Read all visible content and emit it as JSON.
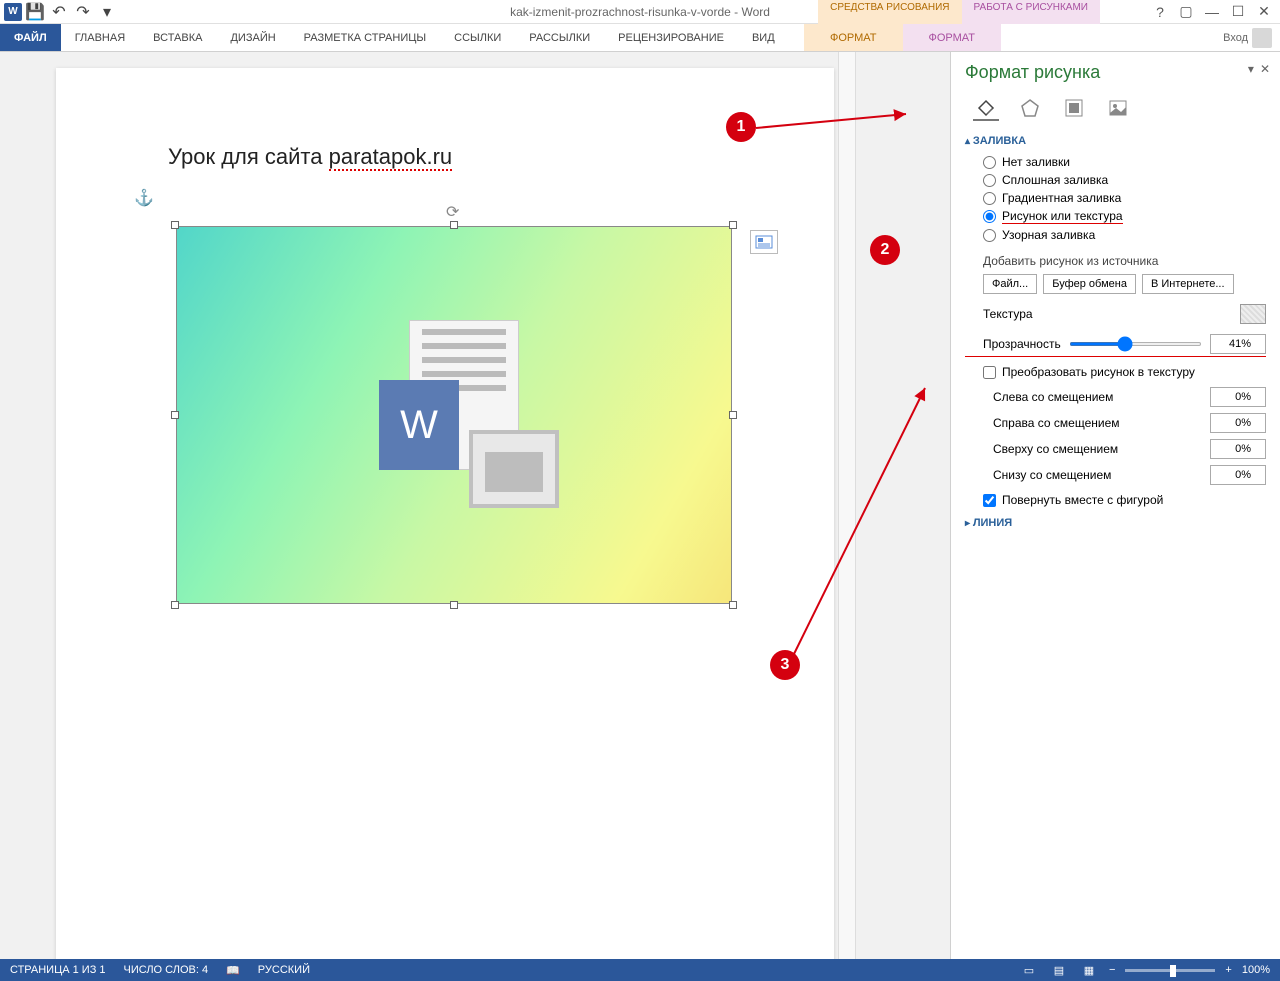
{
  "titlebar": {
    "title": "kak-izmenit-prozrachnost-risunka-v-vorde - Word",
    "login": "Вход"
  },
  "contextual": {
    "drawing": {
      "label": "СРЕДСТВА РИСОВАНИЯ",
      "sub": "ФОРМАТ"
    },
    "pictures": {
      "label": "РАБОТА С РИСУНКАМИ",
      "sub": "ФОРМАТ"
    }
  },
  "ribbon": {
    "tabs": [
      "ФАЙЛ",
      "ГЛАВНАЯ",
      "ВСТАВКА",
      "ДИЗАЙН",
      "РАЗМЕТКА СТРАНИЦЫ",
      "ССЫЛКИ",
      "РАССЫЛКИ",
      "РЕЦЕНЗИРОВАНИЕ",
      "ВИД"
    ]
  },
  "document": {
    "heading_prefix": "Урок для сайта ",
    "heading_link": "paratapok.ru"
  },
  "pane": {
    "title": "Формат рисунка",
    "fill_header": "ЗАЛИВКА",
    "line_header": "ЛИНИЯ",
    "radios": {
      "none": "Нет заливки",
      "solid": "Сплошная заливка",
      "gradient": "Градиентная заливка",
      "picture": "Рисунок или текстура",
      "pattern": "Узорная заливка"
    },
    "source_label": "Добавить рисунок из источника",
    "buttons": {
      "file": "Файл...",
      "clipboard": "Буфер обмена",
      "online": "В Интернете..."
    },
    "texture_label": "Текстура",
    "transparency_label": "Прозрачность",
    "transparency_value": "41%",
    "tile_label": "Преобразовать рисунок в текстуру",
    "offsets": {
      "left": "Слева со смещением",
      "right": "Справа со смещением",
      "top": "Сверху со смещением",
      "bottom": "Снизу со смещением",
      "value": "0%"
    },
    "rotate_label": "Повернуть вместе с фигурой"
  },
  "annotations": {
    "b1": "1",
    "b2": "2",
    "b3": "3"
  },
  "statusbar": {
    "page": "СТРАНИЦА 1 ИЗ 1",
    "words": "ЧИСЛО СЛОВ: 4",
    "lang": "РУССКИЙ",
    "zoom": "100%"
  }
}
